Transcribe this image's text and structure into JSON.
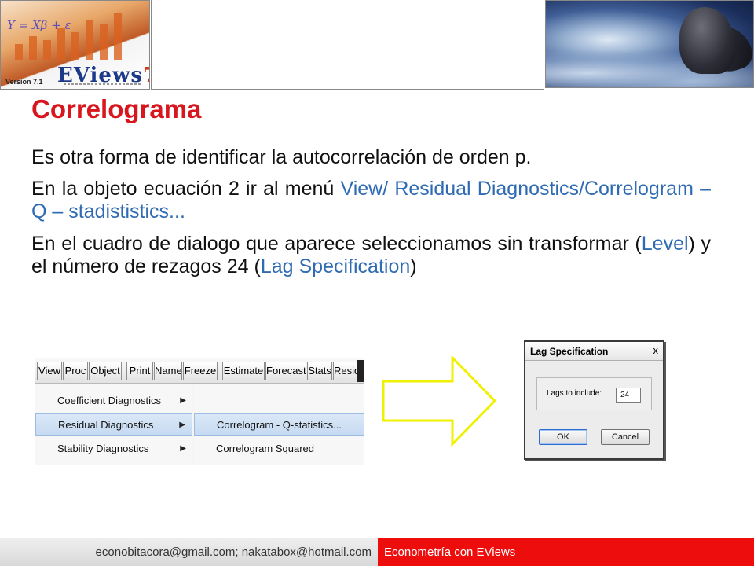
{
  "banner": {
    "logo": {
      "formula": "Y = Xβ + ε",
      "version": "Version 7.1",
      "wordmark": "EViews",
      "wordmark_number": "7"
    }
  },
  "slide": {
    "title": "Correlograma",
    "p1": "Es otra forma de identificar la autocorrelación de orden p.",
    "p2_text": "En la objeto ecuación 2 ir al menú ",
    "p2_highlight": "View/ Residual Diagnostics/Correlogram – Q – stadististics...",
    "p3_text1": "En el cuadro de dialogo que aparece seleccionamos sin transformar (",
    "p3_hl1": "Level",
    "p3_text2": ") y el número de rezagos 24 (",
    "p3_hl2": "Lag Specification",
    "p3_text3": ")"
  },
  "menu_screenshot": {
    "menubar": [
      "View",
      "Proc",
      "Object",
      "Print",
      "Name",
      "Freeze",
      "Estimate",
      "Forecast",
      "Stats",
      "Resids"
    ],
    "submenu1": [
      "Coefficient Diagnostics",
      "Residual Diagnostics",
      "Stability Diagnostics"
    ],
    "submenu2": [
      "Correlogram - Q-statistics...",
      "Correlogram Squared Residuals..."
    ]
  },
  "dialog": {
    "title": "Lag Specification",
    "close": "x",
    "lags_label": "Lags to include:",
    "lags_value": "24",
    "ok": "OK",
    "cancel": "Cancel"
  },
  "footer": {
    "contact": "econobitacora@gmail.com;  nakatabox@hotmail.com",
    "course": "Econometría con EViews"
  },
  "colors": {
    "title": "#d8161e",
    "highlight": "#2f6bb3",
    "footer_red": "#ee0d0d",
    "arrow": "#f0f000"
  }
}
